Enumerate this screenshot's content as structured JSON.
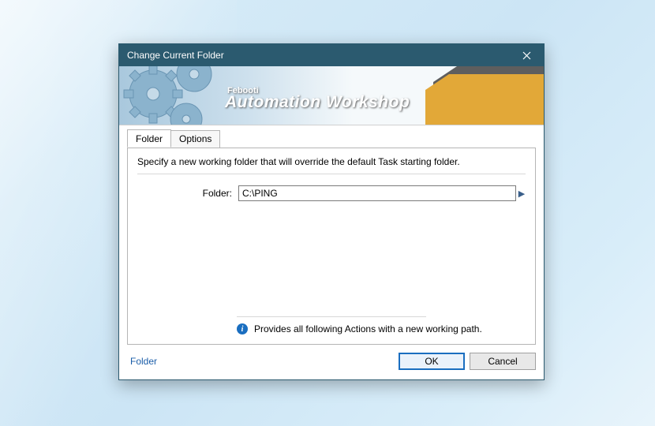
{
  "titlebar": {
    "title": "Change Current Folder"
  },
  "banner": {
    "brand": "Febooti",
    "product": "Automation Workshop"
  },
  "tabs": {
    "folder": "Folder",
    "options": "Options"
  },
  "panel": {
    "description": "Specify a new working folder that will override the default Task starting folder.",
    "folder_label": "Folder:",
    "folder_value": "C:\\PING",
    "hint": "Provides all following Actions with a new working path."
  },
  "footer": {
    "link": "Folder",
    "ok": "OK",
    "cancel": "Cancel"
  }
}
